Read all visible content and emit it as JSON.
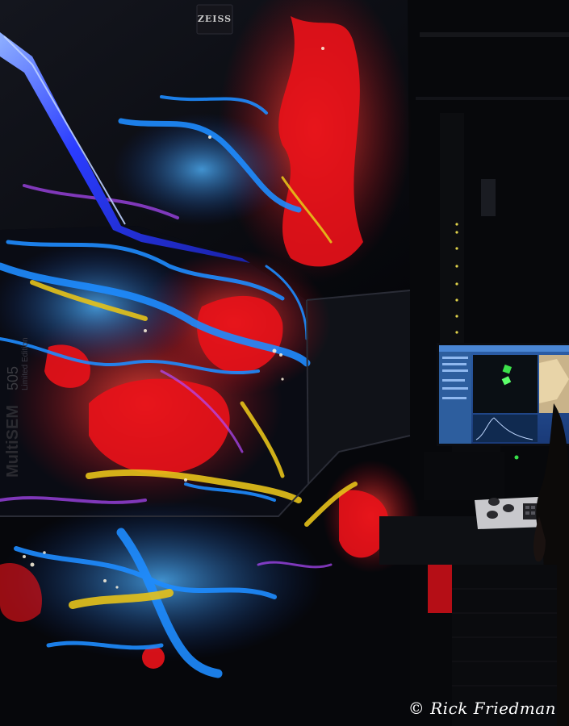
{
  "brand_logo": "ZEISS",
  "machine": {
    "model": "MultiSEM",
    "model_number": "505",
    "edition": "Limited Edition"
  },
  "credit": "© Rick Friedman",
  "colors": {
    "led_strip": "#2a3cff",
    "neuron_red": "#e8121a",
    "neuron_blue": "#1e8cff",
    "neuron_yellow": "#e6c21a",
    "monitor_glow": "#3a78c8"
  }
}
